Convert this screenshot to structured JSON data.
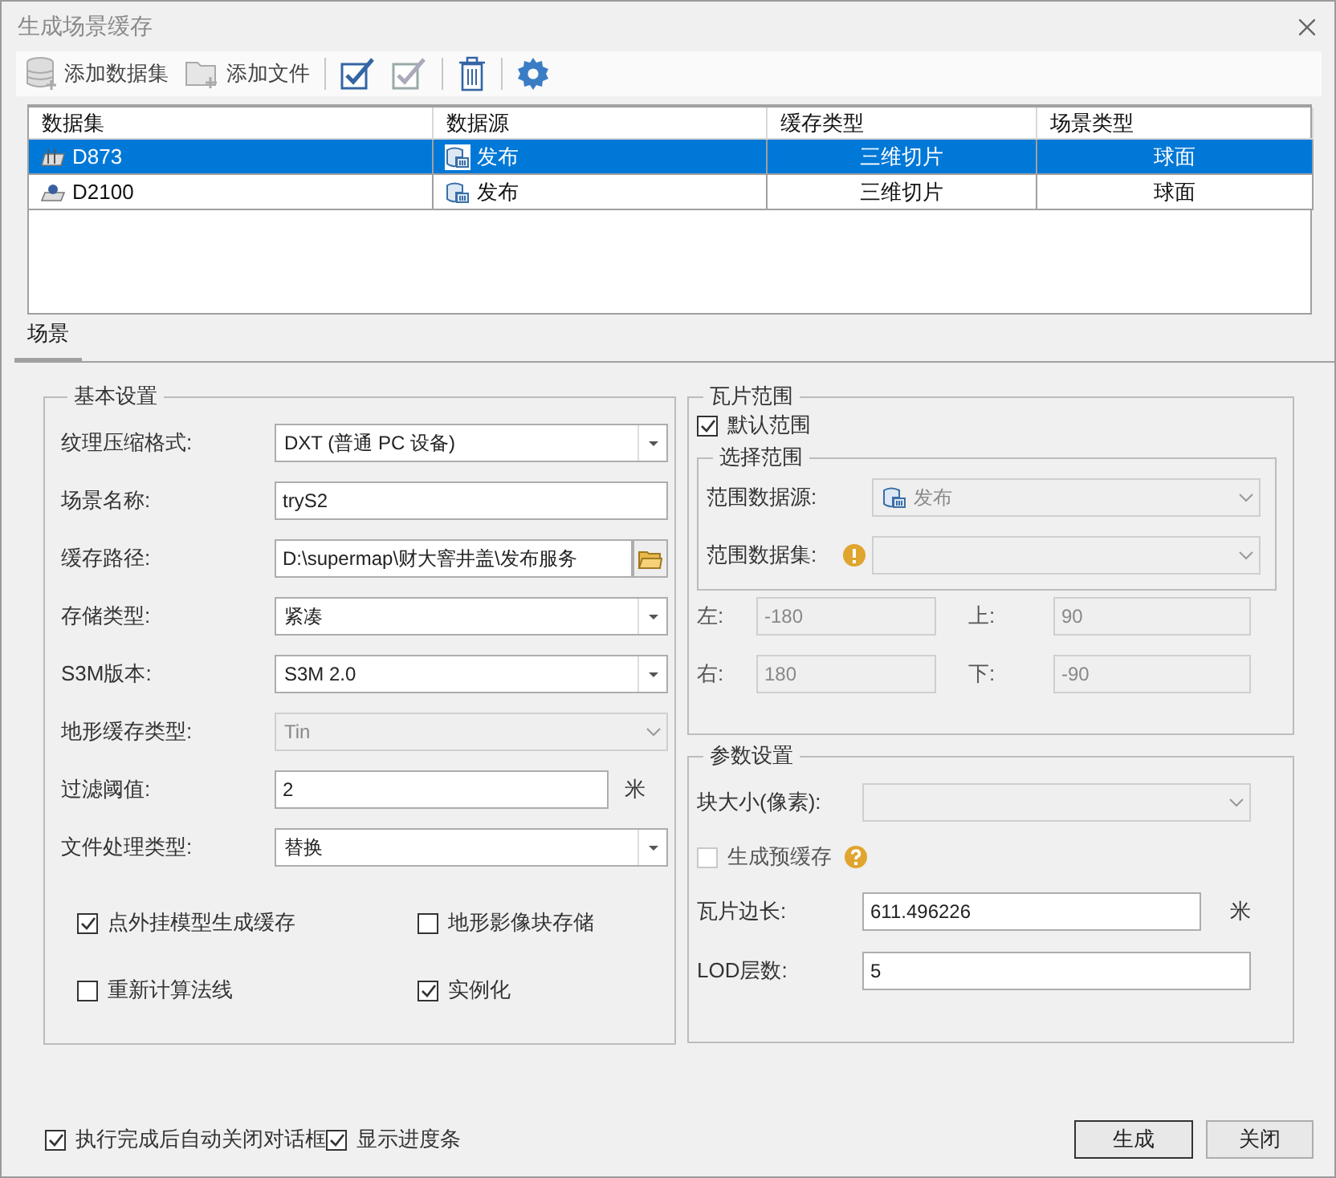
{
  "window": {
    "title": "生成场景缓存"
  },
  "toolbar": [
    {
      "kind": "add-dataset",
      "label": "添加数据集"
    },
    {
      "kind": "add-file",
      "label": "添加文件"
    },
    {
      "kind": "select-all"
    },
    {
      "kind": "select-none"
    },
    {
      "kind": "delete"
    },
    {
      "kind": "settings"
    }
  ],
  "table": {
    "columns": [
      "数据集",
      "数据源",
      "缓存类型",
      "场景类型"
    ],
    "rows": [
      {
        "dataset": "D873",
        "kind": "region",
        "datasource": "发布",
        "cache_type": "三维切片",
        "scene_type": "球面",
        "selected": true
      },
      {
        "dataset": "D2100",
        "kind": "point",
        "datasource": "发布",
        "cache_type": "三维切片",
        "scene_type": "球面",
        "selected": false
      }
    ]
  },
  "tabs": [
    {
      "label": "场景",
      "selected": true
    }
  ],
  "basic_settings": {
    "title": "基本设置",
    "fields": [
      {
        "kind": "select",
        "label": "纹理压缩格式:",
        "value": "DXT (普通 PC 设备)",
        "disabled": false
      },
      {
        "kind": "text",
        "label": "场景名称:",
        "value": "tryS2"
      },
      {
        "kind": "path",
        "label": "缓存路径:",
        "value": "D:\\supermap\\财大窨井盖\\发布服务"
      },
      {
        "kind": "select",
        "label": "存储类型:",
        "value": "紧凑",
        "disabled": false
      },
      {
        "kind": "select",
        "label": "S3M版本:",
        "value": "S3M 2.0",
        "disabled": false
      },
      {
        "kind": "select",
        "label": "地形缓存类型:",
        "value": "Tin",
        "disabled": true
      },
      {
        "kind": "text",
        "label": "过滤阈值:",
        "value": "2",
        "unit": "米"
      },
      {
        "kind": "select",
        "label": "文件处理类型:",
        "value": "替换",
        "disabled": false
      }
    ],
    "checkboxes": [
      {
        "label": "点外挂模型生成缓存",
        "checked": true
      },
      {
        "label": "地形影像块存储",
        "checked": false
      },
      {
        "label": "重新计算法线",
        "checked": false
      },
      {
        "label": "实例化",
        "checked": true
      }
    ]
  },
  "tile_range": {
    "title": "瓦片范围",
    "default_range": {
      "label": "默认范围",
      "checked": true
    },
    "select_range": {
      "title": "选择范围",
      "fields": [
        {
          "label": "范围数据源:",
          "value": "发布",
          "warning": false
        },
        {
          "label": "范围数据集:",
          "warning": true
        }
      ]
    },
    "bounds": [
      {
        "label": "左:",
        "value": "-180"
      },
      {
        "label": "上:",
        "value": "90"
      },
      {
        "label": "右:",
        "value": "180"
      },
      {
        "label": "下:",
        "value": "-90"
      }
    ]
  },
  "parameters": {
    "title": "参数设置",
    "block_size": {
      "label": "块大小(像素):"
    },
    "pre_cache": {
      "label": "生成预缓存",
      "checked": false
    },
    "tile_length": {
      "label": "瓦片边长:",
      "value": "611.496226",
      "unit": "米"
    },
    "lod_levels": {
      "label": "LOD层数:",
      "value": "5"
    }
  },
  "footer": {
    "checkboxes": [
      {
        "label": "执行完成后自动关闭对话框",
        "checked": true
      },
      {
        "label": "显示进度条",
        "checked": true
      }
    ],
    "buttons": [
      {
        "label": "生成",
        "default": true
      },
      {
        "label": "关闭",
        "default": false
      }
    ]
  }
}
